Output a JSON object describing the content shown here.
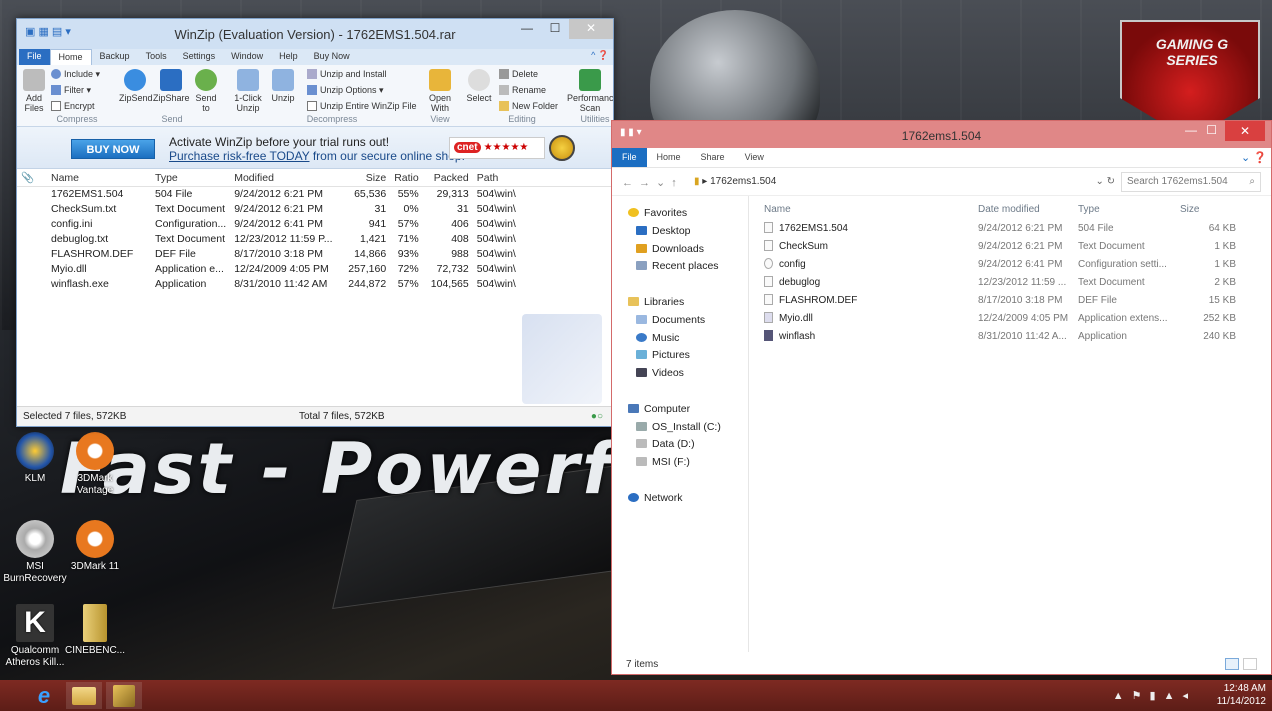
{
  "winzip": {
    "title": "WinZip (Evaluation Version) - 1762EMS1.504.rar",
    "tabs": [
      "File",
      "Home",
      "Backup",
      "Tools",
      "Settings",
      "Window",
      "Help",
      "Buy Now"
    ],
    "ribbon": {
      "include": "Include",
      "filter": "Filter",
      "encrypt": "Encrypt",
      "add_files": "Add Files",
      "zipsend": "ZipSend",
      "zipshare": "ZipShare",
      "send_to": "Send to",
      "one_click_unzip": "1-Click Unzip",
      "unzip": "Unzip",
      "unzip_and_install": "Unzip and Install",
      "unzip_options": "Unzip Options",
      "unzip_entire": "Unzip Entire WinZip File",
      "open_with": "Open With",
      "select": "Select",
      "delete": "Delete",
      "rename": "Rename",
      "new_folder": "New Folder",
      "performance": "Performance Scan",
      "groups": [
        "Compress",
        "Send",
        "Decompress",
        "View",
        "Editing",
        "Utilities"
      ]
    },
    "promo": {
      "buy_now": "BUY NOW",
      "line1": "Activate WinZip before your trial runs out!",
      "line2_link": "Purchase risk-free TODAY",
      "line2_rest": " from our secure online shop.",
      "cnet": "cnet",
      "stars": "★★★★★"
    },
    "columns": [
      "Name",
      "Type",
      "Modified",
      "Size",
      "Ratio",
      "Packed",
      "Path"
    ],
    "rows": [
      {
        "name": "1762EMS1.504",
        "type": "504 File",
        "modified": "9/24/2012 6:21 PM",
        "size": "65,536",
        "ratio": "55%",
        "packed": "29,313",
        "path": "504\\win\\"
      },
      {
        "name": "CheckSum.txt",
        "type": "Text Document",
        "modified": "9/24/2012 6:21 PM",
        "size": "31",
        "ratio": "0%",
        "packed": "31",
        "path": "504\\win\\"
      },
      {
        "name": "config.ini",
        "type": "Configuration...",
        "modified": "9/24/2012 6:41 PM",
        "size": "941",
        "ratio": "57%",
        "packed": "406",
        "path": "504\\win\\"
      },
      {
        "name": "debuglog.txt",
        "type": "Text Document",
        "modified": "12/23/2012 11:59 P...",
        "size": "1,421",
        "ratio": "71%",
        "packed": "408",
        "path": "504\\win\\"
      },
      {
        "name": "FLASHROM.DEF",
        "type": "DEF File",
        "modified": "8/17/2010 3:18 PM",
        "size": "14,866",
        "ratio": "93%",
        "packed": "988",
        "path": "504\\win\\"
      },
      {
        "name": "Myio.dll",
        "type": "Application e...",
        "modified": "12/24/2009 4:05 PM",
        "size": "257,160",
        "ratio": "72%",
        "packed": "72,732",
        "path": "504\\win\\"
      },
      {
        "name": "winflash.exe",
        "type": "Application",
        "modified": "8/31/2010 11:42 AM",
        "size": "244,872",
        "ratio": "57%",
        "packed": "104,565",
        "path": "504\\win\\"
      }
    ],
    "status_left": "Selected 7 files, 572KB",
    "status_center": "Total 7 files, 572KB"
  },
  "explorer": {
    "title": "1762ems1.504",
    "tabs": [
      "File",
      "Home",
      "Share",
      "View"
    ],
    "path": "1762ems1.504",
    "search_placeholder": "Search 1762ems1.504",
    "nav": [
      "Favorites",
      "Desktop",
      "Downloads",
      "Recent places",
      "",
      "Libraries",
      "Documents",
      "Music",
      "Pictures",
      "Videos",
      "",
      "Computer",
      "OS_Install (C:)",
      "Data (D:)",
      "MSI (F:)",
      "",
      "Network"
    ],
    "columns": [
      "Name",
      "Date modified",
      "Type",
      "Size"
    ],
    "rows": [
      {
        "name": "1762EMS1.504",
        "date": "9/24/2012 6:21 PM",
        "type": "504 File",
        "size": "64 KB"
      },
      {
        "name": "CheckSum",
        "date": "9/24/2012 6:21 PM",
        "type": "Text Document",
        "size": "1 KB"
      },
      {
        "name": "config",
        "date": "9/24/2012 6:41 PM",
        "type": "Configuration setti...",
        "size": "1 KB"
      },
      {
        "name": "debuglog",
        "date": "12/23/2012 11:59 ...",
        "type": "Text Document",
        "size": "2 KB"
      },
      {
        "name": "FLASHROM.DEF",
        "date": "8/17/2010 3:18 PM",
        "type": "DEF File",
        "size": "15 KB"
      },
      {
        "name": "Myio.dll",
        "date": "12/24/2009 4:05 PM",
        "type": "Application extens...",
        "size": "252 KB"
      },
      {
        "name": "winflash",
        "date": "8/31/2010 11:42 A...",
        "type": "Application",
        "size": "240 KB"
      }
    ],
    "status": "7 items"
  },
  "desktop": {
    "icons": [
      {
        "label": "KLM"
      },
      {
        "label": "3DMark Vantage"
      },
      {
        "label": "MSI BurnRecovery"
      },
      {
        "label": "3DMark 11"
      },
      {
        "label": "Qualcomm Atheros Kill..."
      },
      {
        "label": "CINEBENC..."
      }
    ],
    "wallpaper_text": "Fast - Powerf",
    "gaming_series": "GAMING G SERIES"
  },
  "taskbar": {
    "time": "12:48 AM",
    "date": "11/14/2012"
  }
}
